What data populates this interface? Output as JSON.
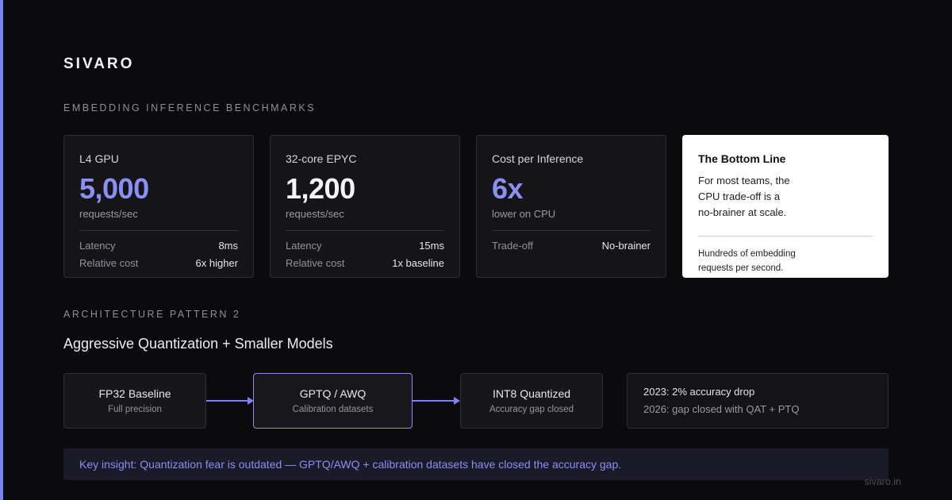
{
  "brand": "SIVARO",
  "benchmarks": {
    "section_label": "EMBEDDING INFERENCE BENCHMARKS",
    "cards": [
      {
        "title": "L4 GPU",
        "value": "5,000",
        "unit": "requests/sec",
        "rows": [
          {
            "label": "Latency",
            "value": "8ms"
          },
          {
            "label": "Relative cost",
            "value": "6x higher"
          }
        ]
      },
      {
        "title": "32-core EPYC",
        "value": "1,200",
        "unit": "requests/sec",
        "rows": [
          {
            "label": "Latency",
            "value": "15ms"
          },
          {
            "label": "Relative cost",
            "value": "1x baseline"
          }
        ]
      },
      {
        "title": "Cost per Inference",
        "value": "6x",
        "unit": "lower on CPU",
        "rows": [
          {
            "label": "Trade-off",
            "value": "No-brainer"
          }
        ]
      }
    ],
    "bottom_line": {
      "title": "The Bottom Line",
      "body": "For most teams, the CPU trade-off is a no-brainer at scale.",
      "footnote": "Hundreds of embedding requests per second."
    }
  },
  "architecture": {
    "section_label": "ARCHITECTURE PATTERN 2",
    "heading": "Aggressive Quantization + Smaller Models",
    "steps": [
      {
        "name": "FP32 Baseline",
        "sub": "Full precision"
      },
      {
        "name": "GPTQ / AWQ",
        "sub": "Calibration datasets"
      },
      {
        "name": "INT8 Quantized",
        "sub": "Accuracy gap closed"
      }
    ],
    "note": {
      "line1": "2023: 2% accuracy drop",
      "line2": "2026: gap closed with QAT + PTQ"
    }
  },
  "insight": "Key insight: Quantization fear is outdated — GPTQ/AWQ + calibration datasets have closed the accuracy gap.",
  "footer_url": "sivaro.in",
  "colors": {
    "accent": "#8a8ff3",
    "background": "#0b0b0d",
    "card": "#151518"
  }
}
